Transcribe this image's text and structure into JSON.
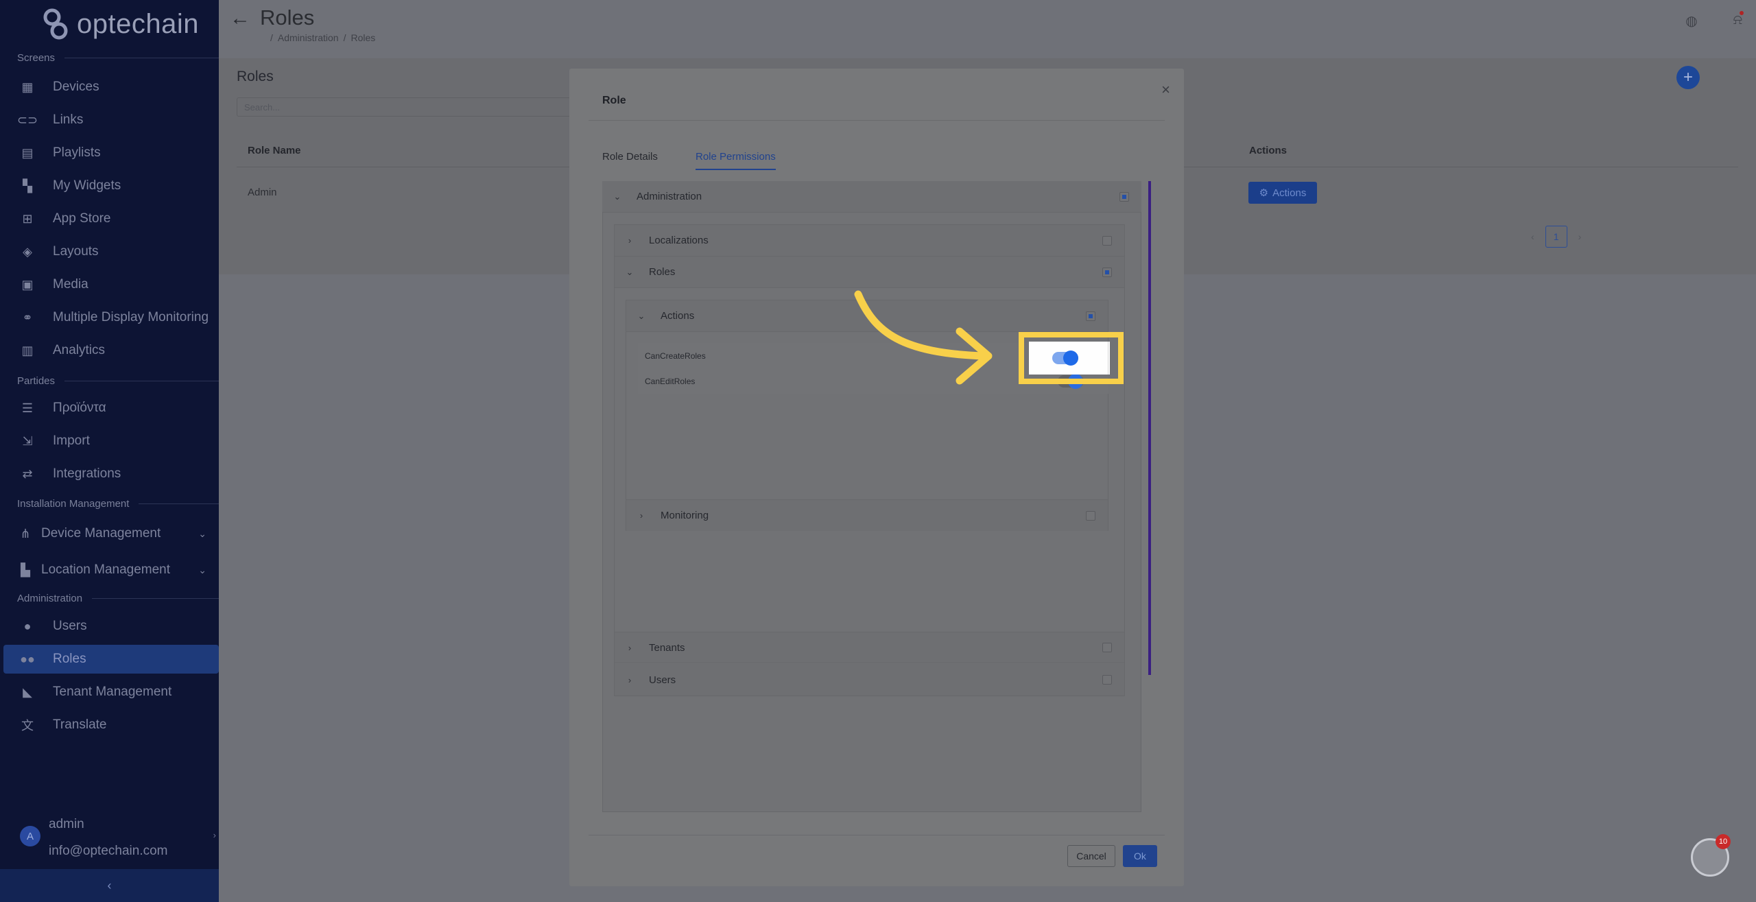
{
  "app": {
    "logo_text": "optechain"
  },
  "sidebar": {
    "sections": {
      "screens": "Screens",
      "partides": "Partides",
      "installation": "Installation Management",
      "administration": "Administration"
    },
    "items": {
      "devices": "Devices",
      "links": "Links",
      "playlists": "Playlists",
      "my_widgets": "My Widgets",
      "app_store": "App Store",
      "layouts": "Layouts",
      "media": "Media",
      "multi_display": "Multiple Display Monitoring",
      "analytics": "Analytics",
      "products": "Προϊόντα",
      "import": "Import",
      "integrations": "Integrations",
      "device_management": "Device Management",
      "location_management": "Location Management",
      "users": "Users",
      "roles": "Roles",
      "tenant_management": "Tenant Management",
      "translate": "Translate"
    },
    "user": {
      "avatar_letter": "A",
      "name": "admin",
      "email": "info@optechain.com"
    }
  },
  "header": {
    "title": "Roles",
    "breadcrumb": [
      "Administration",
      "Roles"
    ]
  },
  "list": {
    "title": "Roles",
    "search_placeholder": "Search...",
    "columns": {
      "role_name": "Role Name",
      "actions": "Actions"
    },
    "rows": [
      {
        "name": "Admin",
        "action_label": "Actions"
      }
    ],
    "page": "1"
  },
  "modal": {
    "title": "Role",
    "tabs": {
      "details": "Role Details",
      "permissions": "Role Permissions"
    },
    "tree": {
      "administration": "Administration",
      "localizations": "Localizations",
      "roles": "Roles",
      "actions": "Actions",
      "perm_create": "CanCreateRoles",
      "perm_edit": "CanEditRoles",
      "monitoring": "Monitoring",
      "tenants": "Tenants",
      "users": "Users"
    },
    "toggles": {
      "can_create_roles": true
    },
    "buttons": {
      "cancel": "Cancel",
      "ok": "Ok"
    }
  },
  "help_badge": "10",
  "colors": {
    "accent": "#1f6ae8",
    "highlight": "#f8d04a",
    "sidebar_bg": "#0d1434"
  }
}
